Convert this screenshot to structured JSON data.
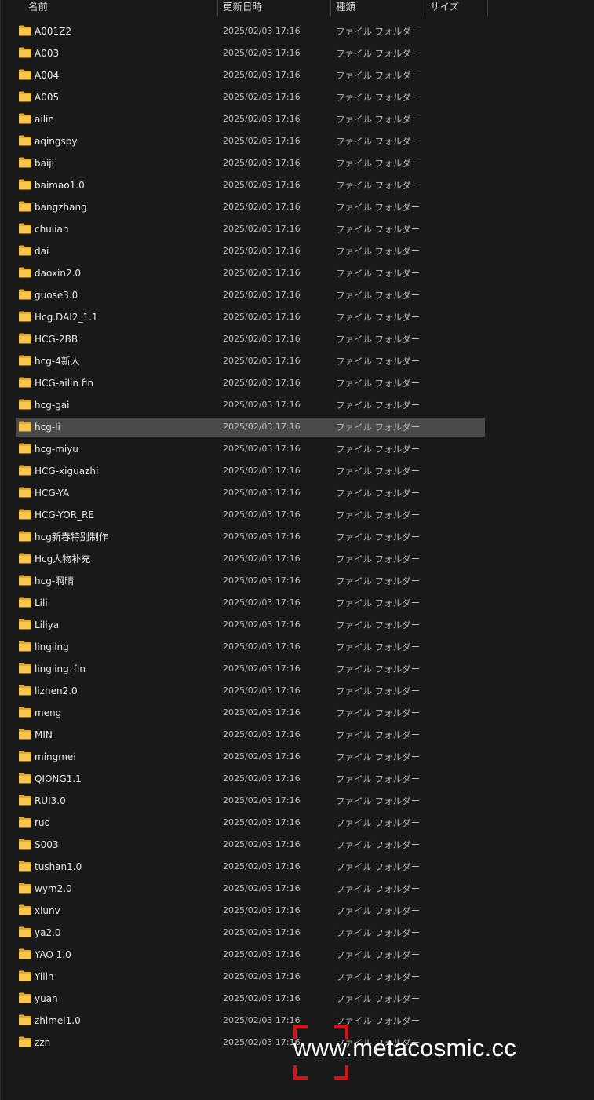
{
  "columns": {
    "name": "名前",
    "modified": "更新日時",
    "type": "種類",
    "size": "サイズ"
  },
  "folder_icon": "folder-icon",
  "folder_color": "#f8c64b",
  "selected_index": 18,
  "rows": [
    {
      "name": "A001Z2",
      "date": "2025/02/03 17:16",
      "type": "ファイル フォルダー"
    },
    {
      "name": "A003",
      "date": "2025/02/03 17:16",
      "type": "ファイル フォルダー"
    },
    {
      "name": "A004",
      "date": "2025/02/03 17:16",
      "type": "ファイル フォルダー"
    },
    {
      "name": "A005",
      "date": "2025/02/03 17:16",
      "type": "ファイル フォルダー"
    },
    {
      "name": "ailin",
      "date": "2025/02/03 17:16",
      "type": "ファイル フォルダー"
    },
    {
      "name": "aqingspy",
      "date": "2025/02/03 17:16",
      "type": "ファイル フォルダー"
    },
    {
      "name": "baiji",
      "date": "2025/02/03 17:16",
      "type": "ファイル フォルダー"
    },
    {
      "name": "baimao1.0",
      "date": "2025/02/03 17:16",
      "type": "ファイル フォルダー"
    },
    {
      "name": "bangzhang",
      "date": "2025/02/03 17:16",
      "type": "ファイル フォルダー"
    },
    {
      "name": "chulian",
      "date": "2025/02/03 17:16",
      "type": "ファイル フォルダー"
    },
    {
      "name": "dai",
      "date": "2025/02/03 17:16",
      "type": "ファイル フォルダー"
    },
    {
      "name": "daoxin2.0",
      "date": "2025/02/03 17:16",
      "type": "ファイル フォルダー"
    },
    {
      "name": "guose3.0",
      "date": "2025/02/03 17:16",
      "type": "ファイル フォルダー"
    },
    {
      "name": "Hcg.DAI2_1.1",
      "date": "2025/02/03 17:16",
      "type": "ファイル フォルダー"
    },
    {
      "name": "HCG-2BB",
      "date": "2025/02/03 17:16",
      "type": "ファイル フォルダー"
    },
    {
      "name": "hcg-4新人",
      "date": "2025/02/03 17:16",
      "type": "ファイル フォルダー"
    },
    {
      "name": "HCG-ailin fin",
      "date": "2025/02/03 17:16",
      "type": "ファイル フォルダー"
    },
    {
      "name": "hcg-gai",
      "date": "2025/02/03 17:16",
      "type": "ファイル フォルダー"
    },
    {
      "name": "hcg-li",
      "date": "2025/02/03 17:16",
      "type": "ファイル フォルダー"
    },
    {
      "name": "hcg-miyu",
      "date": "2025/02/03 17:16",
      "type": "ファイル フォルダー"
    },
    {
      "name": "HCG-xiguazhi",
      "date": "2025/02/03 17:16",
      "type": "ファイル フォルダー"
    },
    {
      "name": "HCG-YA",
      "date": "2025/02/03 17:16",
      "type": "ファイル フォルダー"
    },
    {
      "name": "HCG-YOR_RE",
      "date": "2025/02/03 17:16",
      "type": "ファイル フォルダー"
    },
    {
      "name": "hcg新春特别制作",
      "date": "2025/02/03 17:16",
      "type": "ファイル フォルダー"
    },
    {
      "name": "Hcg人物补充",
      "date": "2025/02/03 17:16",
      "type": "ファイル フォルダー"
    },
    {
      "name": "hcg-啊晴",
      "date": "2025/02/03 17:16",
      "type": "ファイル フォルダー"
    },
    {
      "name": "Lili",
      "date": "2025/02/03 17:16",
      "type": "ファイル フォルダー"
    },
    {
      "name": "Liliya",
      "date": "2025/02/03 17:16",
      "type": "ファイル フォルダー"
    },
    {
      "name": "lingling",
      "date": "2025/02/03 17:16",
      "type": "ファイル フォルダー"
    },
    {
      "name": "lingling_fin",
      "date": "2025/02/03 17:16",
      "type": "ファイル フォルダー"
    },
    {
      "name": "lizhen2.0",
      "date": "2025/02/03 17:16",
      "type": "ファイル フォルダー"
    },
    {
      "name": "meng",
      "date": "2025/02/03 17:16",
      "type": "ファイル フォルダー"
    },
    {
      "name": "MIN",
      "date": "2025/02/03 17:16",
      "type": "ファイル フォルダー"
    },
    {
      "name": "mingmei",
      "date": "2025/02/03 17:16",
      "type": "ファイル フォルダー"
    },
    {
      "name": "QIONG1.1",
      "date": "2025/02/03 17:16",
      "type": "ファイル フォルダー"
    },
    {
      "name": "RUI3.0",
      "date": "2025/02/03 17:16",
      "type": "ファイル フォルダー"
    },
    {
      "name": "ruo",
      "date": "2025/02/03 17:16",
      "type": "ファイル フォルダー"
    },
    {
      "name": "S003",
      "date": "2025/02/03 17:16",
      "type": "ファイル フォルダー"
    },
    {
      "name": "tushan1.0",
      "date": "2025/02/03 17:16",
      "type": "ファイル フォルダー"
    },
    {
      "name": "wym2.0",
      "date": "2025/02/03 17:16",
      "type": "ファイル フォルダー"
    },
    {
      "name": "xiunv",
      "date": "2025/02/03 17:16",
      "type": "ファイル フォルダー"
    },
    {
      "name": "ya2.0",
      "date": "2025/02/03 17:16",
      "type": "ファイル フォルダー"
    },
    {
      "name": "YAO 1.0",
      "date": "2025/02/03 17:16",
      "type": "ファイル フォルダー"
    },
    {
      "name": "Yilin",
      "date": "2025/02/03 17:16",
      "type": "ファイル フォルダー"
    },
    {
      "name": "yuan",
      "date": "2025/02/03 17:16",
      "type": "ファイル フォルダー"
    },
    {
      "name": "zhimei1.0",
      "date": "2025/02/03 17:16",
      "type": "ファイル フォルダー"
    },
    {
      "name": "zzn",
      "date": "2025/02/03 17:16",
      "type": "ファイル フォルダー"
    }
  ],
  "watermark": {
    "text": "www.metacosmic.cc",
    "color": "#e01010"
  }
}
